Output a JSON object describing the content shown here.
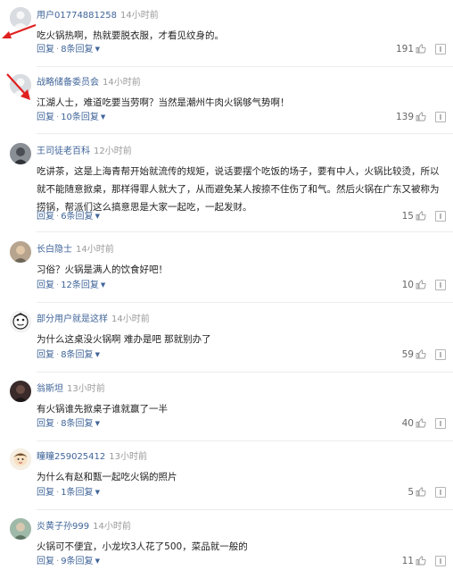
{
  "labels": {
    "reply": "回复",
    "sep": "·"
  },
  "comments": [
    {
      "user": "用户01774881258",
      "time": "14小时前",
      "text": "吃火锅热啊，热就要脱衣服，才看见纹身的。",
      "replies": "8条回复",
      "likes": "191",
      "avatar_icon": "default-user-avatar-icon"
    },
    {
      "user": "战略储备委员会",
      "time": "14小时前",
      "text": "江湖人士，难道吃要当劳啊？当然是潮州牛肉火锅够气势啊！",
      "replies": "10条回复",
      "likes": "139",
      "avatar_icon": "default-user-avatar-icon"
    },
    {
      "user": "王司徒老百科",
      "time": "12小时前",
      "text": "吃讲茶，这是上海青帮开始就流传的规矩，说话要摆个吃饭的场子，要有中人，火锅比较烫，所以就不能随意掀桌，那样得罪人就大了，从而避免某人按捺不住伤了和气。然后火锅在广东又被称为捞锅，帮派们这么搞意思是大家一起吃，一起发财。",
      "replies": "6条回复",
      "likes": "15",
      "avatar_icon": "photo-avatar-icon"
    },
    {
      "user": "长白隐士",
      "time": "14小时前",
      "text": "习俗？火锅是满人的饮食好吧！",
      "replies": "12条回复",
      "likes": "10",
      "avatar_icon": "photo-avatar-icon"
    },
    {
      "user": "部分用户就是这样",
      "time": "14小时前",
      "text": "为什么这桌没火锅啊 难办是吧 那就别办了",
      "replies": "8条回复",
      "likes": "59",
      "avatar_icon": "cartoon-avatar-icon"
    },
    {
      "user": "翁斯坦",
      "time": "13小时前",
      "text": "有火锅谁先掀桌子谁就赢了一半",
      "replies": "8条回复",
      "likes": "40",
      "avatar_icon": "photo-avatar-icon"
    },
    {
      "user": "瞳瞳259025412",
      "time": "13小时前",
      "text": "为什么有赵和甄一起吃火锅的照片",
      "replies": "1条回复",
      "likes": "5",
      "avatar_icon": "cartoon-avatar-icon"
    },
    {
      "user": "炎黄子孙999",
      "time": "14小时前",
      "text": "火锅可不便宜，小龙坎3人花了500，菜品就一般的",
      "replies": "9条回复",
      "likes": "11",
      "avatar_icon": "photo-avatar-icon"
    }
  ],
  "colors": {
    "username": "#406599",
    "time": "#999999",
    "text": "#222222",
    "annotation_arrow": "#e02020"
  }
}
